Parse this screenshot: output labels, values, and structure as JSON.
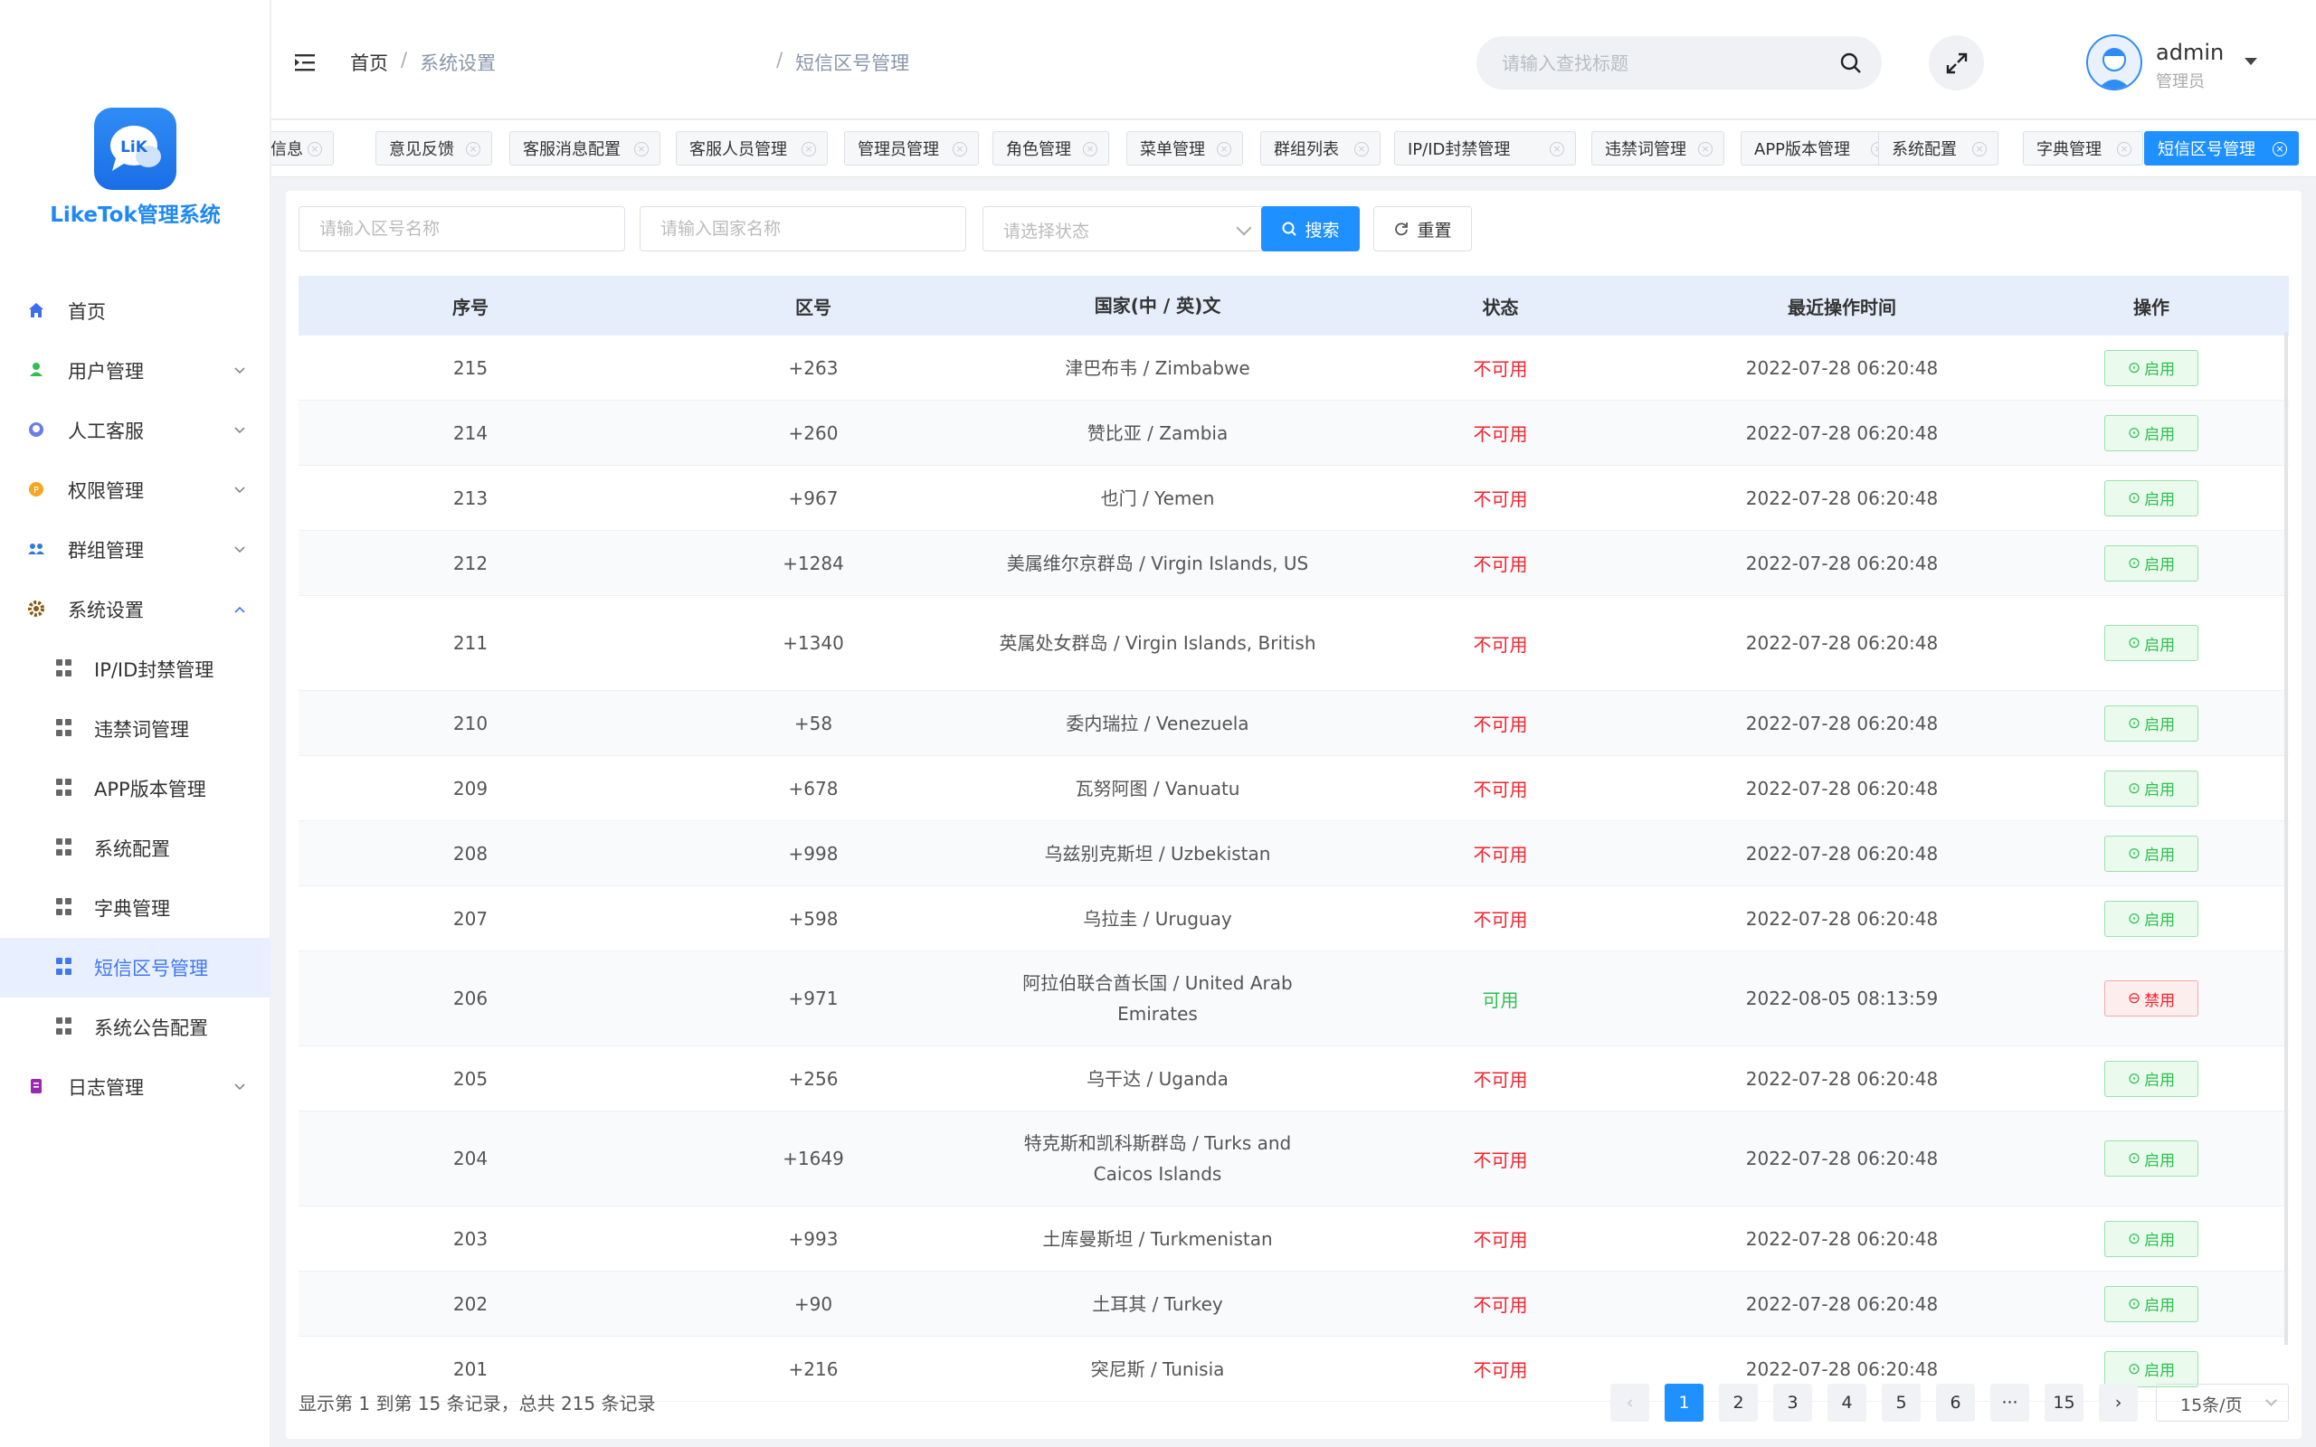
{
  "app": {
    "brand": "LikeTok管理系统",
    "logo_text": "LiK"
  },
  "colors": {
    "accent": "#1e90ff",
    "brand": "#1e88f5",
    "danger": "#f5222d",
    "success": "#2fbf4f"
  },
  "sidebar": {
    "items": [
      {
        "label": "首页",
        "icon": "home-icon"
      },
      {
        "label": "用户管理",
        "icon": "user-icon"
      },
      {
        "label": "人工客服",
        "icon": "customer-service-icon"
      },
      {
        "label": "权限管理",
        "icon": "permission-icon"
      },
      {
        "label": "群组管理",
        "icon": "group-icon"
      },
      {
        "label": "系统设置",
        "icon": "gear-icon"
      },
      {
        "label": "IP/ID封禁管理",
        "icon": "grid-icon"
      },
      {
        "label": "违禁词管理",
        "icon": "grid-icon"
      },
      {
        "label": "APP版本管理",
        "icon": "grid-icon"
      },
      {
        "label": "系统配置",
        "icon": "grid-icon"
      },
      {
        "label": "字典管理",
        "icon": "grid-icon"
      },
      {
        "label": "短信区号管理",
        "icon": "grid-icon"
      },
      {
        "label": "系统公告配置",
        "icon": "grid-icon"
      },
      {
        "label": "日志管理",
        "icon": "log-icon"
      }
    ]
  },
  "header": {
    "breadcrumb": [
      "首页",
      "系统设置",
      "短信区号管理"
    ],
    "search_placeholder": "请输入查找标题",
    "user_name": "admin",
    "user_role": "管理员"
  },
  "tags": [
    "报信息",
    "意见反馈",
    "客服消息配置",
    "客服人员管理",
    "管理员管理",
    "角色管理",
    "菜单管理",
    "群组列表",
    "IP/ID封禁管理",
    "违禁词管理",
    "APP版本管理",
    "系统配置",
    "字典管理",
    "短信区号管理"
  ],
  "filters": {
    "code_placeholder": "请输入区号名称",
    "country_placeholder": "请输入国家名称",
    "status_placeholder": "请选择状态",
    "search_label": "搜索",
    "reset_label": "重置"
  },
  "table": {
    "columns": [
      "序号",
      "区号",
      "国家(中 / 英)文",
      "状态",
      "最近操作时间",
      "操作"
    ],
    "rows": [
      {
        "id": "215",
        "code": "+263",
        "country": "津巴布韦 / Zimbabwe",
        "status": "不可用",
        "time": "2022-07-28 06:20:48",
        "action": "启用"
      },
      {
        "id": "214",
        "code": "+260",
        "country": "赞比亚 / Zambia",
        "status": "不可用",
        "time": "2022-07-28 06:20:48",
        "action": "启用"
      },
      {
        "id": "213",
        "code": "+967",
        "country": "也门 / Yemen",
        "status": "不可用",
        "time": "2022-07-28 06:20:48",
        "action": "启用"
      },
      {
        "id": "212",
        "code": "+1284",
        "country": "美属维尔京群岛 / Virgin Islands, US",
        "status": "不可用",
        "time": "2022-07-28 06:20:48",
        "action": "启用"
      },
      {
        "id": "211",
        "code": "+1340",
        "country": "英属处女群岛 / Virgin Islands, British",
        "status": "不可用",
        "time": "2022-07-28 06:20:48",
        "action": "启用"
      },
      {
        "id": "210",
        "code": "+58",
        "country": "委内瑞拉 / Venezuela",
        "status": "不可用",
        "time": "2022-07-28 06:20:48",
        "action": "启用"
      },
      {
        "id": "209",
        "code": "+678",
        "country": "瓦努阿图 / Vanuatu",
        "status": "不可用",
        "time": "2022-07-28 06:20:48",
        "action": "启用"
      },
      {
        "id": "208",
        "code": "+998",
        "country": "乌兹别克斯坦 / Uzbekistan",
        "status": "不可用",
        "time": "2022-07-28 06:20:48",
        "action": "启用"
      },
      {
        "id": "207",
        "code": "+598",
        "country": "乌拉圭 / Uruguay",
        "status": "不可用",
        "time": "2022-07-28 06:20:48",
        "action": "启用"
      },
      {
        "id": "206",
        "code": "+971",
        "country": "阿拉伯联合酋长国 / United Arab Emirates",
        "status": "可用",
        "time": "2022-08-05 08:13:59",
        "action": "禁用"
      },
      {
        "id": "205",
        "code": "+256",
        "country": "乌干达 / Uganda",
        "status": "不可用",
        "time": "2022-07-28 06:20:48",
        "action": "启用"
      },
      {
        "id": "204",
        "code": "+1649",
        "country": "特克斯和凯科斯群岛 / Turks and Caicos Islands",
        "status": "不可用",
        "time": "2022-07-28 06:20:48",
        "action": "启用"
      },
      {
        "id": "203",
        "code": "+993",
        "country": "土库曼斯坦 / Turkmenistan",
        "status": "不可用",
        "time": "2022-07-28 06:20:48",
        "action": "启用"
      },
      {
        "id": "202",
        "code": "+90",
        "country": "土耳其 / Turkey",
        "status": "不可用",
        "time": "2022-07-28 06:20:48",
        "action": "启用"
      },
      {
        "id": "201",
        "code": "+216",
        "country": "突尼斯 / Tunisia",
        "status": "不可用",
        "time": "2022-07-28 06:20:48",
        "action": "启用"
      }
    ]
  },
  "footer": {
    "summary": "显示第 1 到第 15 条记录，总共 215 条记录",
    "pages": [
      "1",
      "2",
      "3",
      "4",
      "5",
      "6",
      "···",
      "15"
    ],
    "current_page": "1",
    "page_size": "15条/页"
  }
}
